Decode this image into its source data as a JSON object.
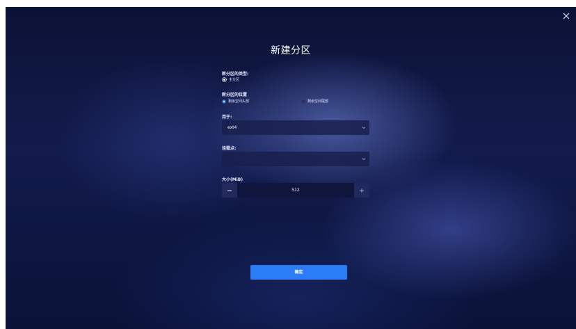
{
  "dialog": {
    "title": "新建分区",
    "close_icon": "close-icon",
    "partition_type": {
      "label": "新分区的类型:",
      "options": [
        {
          "label": "主分区",
          "selected": true
        }
      ]
    },
    "location": {
      "label": "新分区的位置",
      "options": [
        {
          "label": "剩余空间头部",
          "selected": true
        },
        {
          "label": "剩余空间尾部",
          "selected": false
        }
      ]
    },
    "filesystem": {
      "label": "用于:",
      "value": "ext4",
      "icon": "chevron-down-icon"
    },
    "mount_point": {
      "label": "挂载点:",
      "value": "",
      "icon": "chevron-down-icon"
    },
    "size": {
      "label": "大小(MiB)",
      "value": "512",
      "minus_icon": "minus-icon",
      "plus_icon": "plus-icon"
    },
    "confirm_label": "确定"
  },
  "colors": {
    "accent": "#2b7cf7",
    "background": "#121b4c",
    "field": "#19204e"
  }
}
